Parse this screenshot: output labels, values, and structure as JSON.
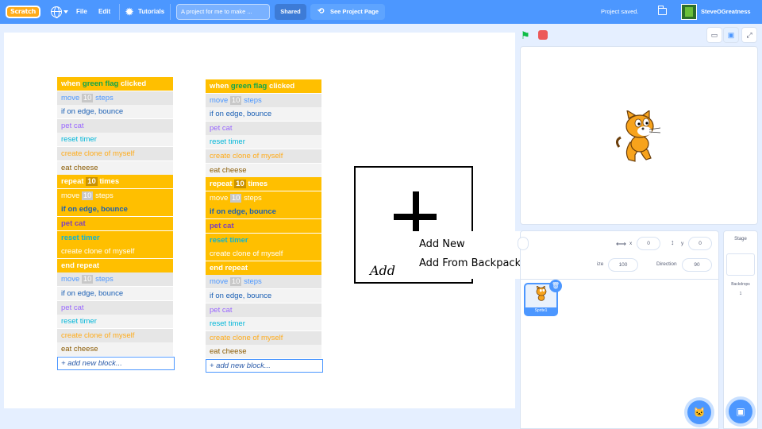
{
  "menubar": {
    "logo_text": "Scratch",
    "file_label": "File",
    "edit_label": "Edit",
    "tutorials_label": "Tutorials",
    "project_title": "A project for me to make ...",
    "shared_label": "Shared",
    "see_project_page_label": "See Project Page",
    "status_text": "Project saved.",
    "username": "SteveOGreatness",
    "icons": [
      "globe-icon",
      "lightbulb-icon",
      "folder-icon"
    ]
  },
  "left_stack": {
    "blocks": [
      {
        "parts": [
          [
            "when ",
            "t-bwhite"
          ],
          [
            "green flag",
            "t-green"
          ],
          [
            " clicked",
            "t-bwhite"
          ]
        ],
        "style": "c-head"
      },
      {
        "parts": [
          [
            "move ",
            "t-blue"
          ],
          [
            "10",
            "num"
          ],
          [
            " steps",
            "t-blue"
          ]
        ],
        "style": "c-grey"
      },
      {
        "parts": [
          [
            "if on edge, bounce",
            "t-dblue"
          ]
        ],
        "style": "c-light"
      },
      {
        "parts": [
          [
            "pet cat",
            "t-purple"
          ]
        ],
        "style": "c-grey"
      },
      {
        "parts": [
          [
            "reset timer",
            "t-cyan"
          ]
        ],
        "style": "c-light"
      },
      {
        "parts": [
          [
            "create clone of myself",
            "t-gold"
          ]
        ],
        "style": "c-grey"
      },
      {
        "parts": [
          [
            "eat cheese",
            "t-brown"
          ]
        ],
        "style": "c-light"
      },
      {
        "parts": [
          [
            "repeat ",
            "t-bwhite"
          ],
          [
            "10",
            "num-y"
          ],
          [
            " times",
            "t-bwhite"
          ]
        ],
        "style": "c-head"
      },
      {
        "parts": [
          [
            "move ",
            "t-white"
          ],
          [
            "10",
            "num"
          ],
          [
            " steps",
            "t-white"
          ]
        ],
        "style": "c-orange"
      },
      {
        "parts": [
          [
            "if on edge, bounce",
            "t-bdblue"
          ]
        ],
        "style": "c-orange"
      },
      {
        "parts": [
          [
            "pet cat",
            "t-bpurple"
          ]
        ],
        "style": "c-orange"
      },
      {
        "parts": [
          [
            "reset timer",
            "t-bcyan"
          ]
        ],
        "style": "c-orange"
      },
      {
        "parts": [
          [
            "create clone of myself",
            "t-white"
          ]
        ],
        "style": "c-orange"
      },
      {
        "parts": [
          [
            "end repeat",
            "t-bwhite"
          ]
        ],
        "style": "c-orange"
      },
      {
        "parts": [
          [
            "move ",
            "t-blue"
          ],
          [
            "10",
            "num"
          ],
          [
            " steps",
            "t-blue"
          ]
        ],
        "style": "c-grey"
      },
      {
        "parts": [
          [
            "if on edge, bounce",
            "t-dblue"
          ]
        ],
        "style": "c-light"
      },
      {
        "parts": [
          [
            "pet cat",
            "t-purple"
          ]
        ],
        "style": "c-grey"
      },
      {
        "parts": [
          [
            "reset timer",
            "t-cyan"
          ]
        ],
        "style": "c-light"
      },
      {
        "parts": [
          [
            "create clone of myself",
            "t-gold"
          ]
        ],
        "style": "c-grey"
      },
      {
        "parts": [
          [
            "eat cheese",
            "t-brown"
          ]
        ],
        "style": "c-light"
      }
    ],
    "add_label": "+ add new block..."
  },
  "right_stack": {
    "blocks": [
      {
        "parts": [
          [
            "when ",
            "t-bwhite"
          ],
          [
            "green flag",
            "t-green"
          ],
          [
            " clicked",
            "t-bwhite"
          ]
        ],
        "style": "c-head"
      },
      {
        "parts": [
          [
            "move ",
            "t-blue"
          ],
          [
            "10",
            "num"
          ],
          [
            " steps",
            "t-blue"
          ]
        ],
        "style": "c-grey"
      },
      {
        "parts": [
          [
            "if on edge, bounce",
            "t-dblue"
          ]
        ],
        "style": "c-light"
      },
      {
        "parts": [
          [
            "pet cat",
            "t-purple"
          ]
        ],
        "style": "c-grey"
      },
      {
        "parts": [
          [
            "reset timer",
            "t-cyan"
          ]
        ],
        "style": "c-light"
      },
      {
        "parts": [
          [
            "create clone of myself",
            "t-gold"
          ]
        ],
        "style": "c-grey"
      },
      {
        "parts": [
          [
            "eat cheese",
            "t-brown"
          ]
        ],
        "style": "c-light"
      },
      {
        "parts": [
          [
            "repeat ",
            "t-bwhite"
          ],
          [
            "10",
            "num-y"
          ],
          [
            " times",
            "t-bwhite"
          ]
        ],
        "style": "c-head"
      },
      {
        "parts": [
          [
            "move ",
            "t-white"
          ],
          [
            "10",
            "num"
          ],
          [
            " steps",
            "t-white"
          ]
        ],
        "style": "c-orange"
      },
      {
        "parts": [
          [
            "if on edge, bounce",
            "t-bdblue"
          ]
        ],
        "style": "c-orange"
      },
      {
        "parts": [
          [
            "pet cat",
            "t-bpurple"
          ]
        ],
        "style": "c-orange"
      },
      {
        "parts": [
          [
            "reset timer",
            "t-bcyan"
          ]
        ],
        "style": "c-orange"
      },
      {
        "parts": [
          [
            "create clone of myself",
            "t-white"
          ]
        ],
        "style": "c-orange"
      },
      {
        "parts": [
          [
            "end repeat",
            "t-bwhite"
          ]
        ],
        "style": "c-orange"
      },
      {
        "parts": [
          [
            "move ",
            "t-blue"
          ],
          [
            "10",
            "num"
          ],
          [
            " steps",
            "t-blue"
          ]
        ],
        "style": "c-grey"
      },
      {
        "parts": [
          [
            "if on edge, bounce",
            "t-dblue"
          ]
        ],
        "style": "c-light"
      },
      {
        "parts": [
          [
            "pet cat",
            "t-purple"
          ]
        ],
        "style": "c-grey"
      },
      {
        "parts": [
          [
            "reset timer",
            "t-cyan"
          ]
        ],
        "style": "c-light"
      },
      {
        "parts": [
          [
            "create clone of myself",
            "t-gold"
          ]
        ],
        "style": "c-grey"
      },
      {
        "parts": [
          [
            "eat cheese",
            "t-brown"
          ]
        ],
        "style": "c-light"
      }
    ],
    "add_label": "+ add new block..."
  },
  "sketch": {
    "label": "Add"
  },
  "popup": {
    "items": [
      "Add New",
      "Add From Backpack"
    ]
  },
  "sprite_info": {
    "x_label": "x",
    "x_value": "0",
    "y_label": "y",
    "y_value": "0",
    "size_label": "ize",
    "size_value": "100",
    "direction_label": "Direction",
    "direction_value": "90"
  },
  "sprite_list": {
    "sprite_name": "Sprite1"
  },
  "stage_panel": {
    "title": "Stage",
    "backdrops_label": "Backdrops",
    "backdrops_count": "1"
  },
  "colors": {
    "menubar": "#4c97ff",
    "event": "#ffbf00",
    "accent": "#4c97ff"
  }
}
